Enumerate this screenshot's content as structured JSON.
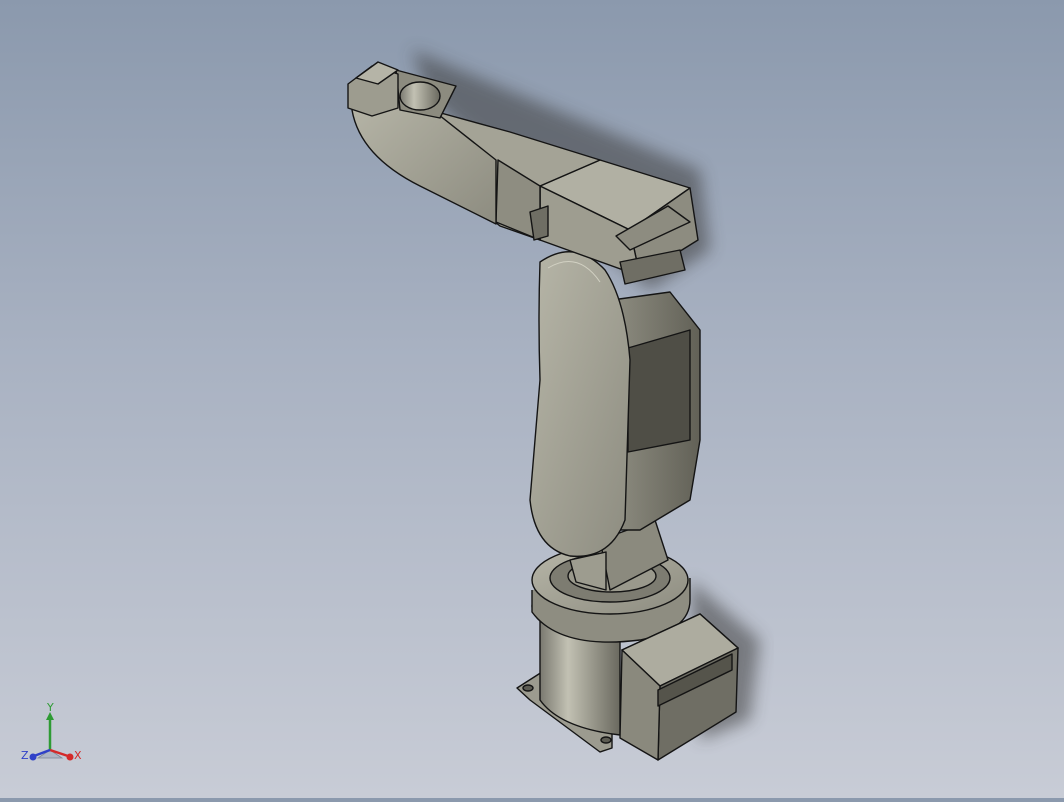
{
  "viewport": {
    "model": "robot-arm"
  },
  "triad": {
    "x_label": "X",
    "y_label": "Y",
    "z_label": "Z",
    "x_color": "#d42a2a",
    "y_color": "#2e9b34",
    "z_color": "#2f40c8"
  },
  "colors": {
    "background_top": "#8b99ad",
    "background_bottom": "#c8ccd6",
    "body_light": "#a9a89b",
    "body_mid": "#86857a",
    "body_dark": "#5c5b52",
    "edge": "#141414"
  }
}
